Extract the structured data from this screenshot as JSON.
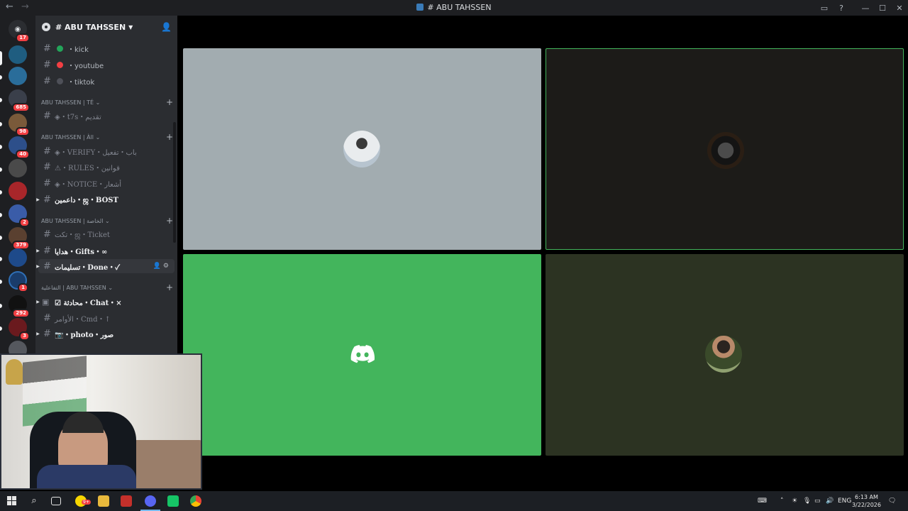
{
  "window": {
    "title": "# ABU TAHSSEN"
  },
  "server_rail": {
    "badges": [
      "17",
      "685",
      "98",
      "40",
      "2",
      "379",
      "1",
      "292",
      "3"
    ]
  },
  "guild": {
    "name": "# ABU TAHSSEN"
  },
  "channels": {
    "top": [
      {
        "label": "・kick",
        "status_color": "#23a55a"
      },
      {
        "label": "・youtube",
        "status_color": "#f23f43"
      },
      {
        "label": "・tiktok",
        "status_color": "#4e5058"
      }
    ],
    "cat1": {
      "label": "ABU TAHSSEN | TÉ"
    },
    "cat1_channels": [
      {
        "label": "◈・t7s・تقديم"
      }
    ],
    "cat2": {
      "label": "ABU TAHSSEN | Àll"
    },
    "cat2_channels": [
      {
        "label": "◈・VERIFY・باب・تفعيل"
      },
      {
        "label": "⚠・RULES・قوانين"
      },
      {
        "label": "◈・NOTICE・أشعار"
      },
      {
        "label": "داعمين・ஜ・BOST"
      }
    ],
    "cat3": {
      "label": "ABU TAHSSEN | الخاصة"
    },
    "cat3_channels": [
      {
        "label": "تكت・ஜ・Ticket"
      },
      {
        "label": "هدايا・Gifts・∞"
      },
      {
        "label": "تسليمات・Done・✓"
      }
    ],
    "cat4": {
      "label": "التفاعلية | ABU TAHSSEN"
    },
    "cat4_channels": [
      {
        "label": "☑ محادثة・Chat・×"
      },
      {
        "label": "الأوامر・Cmd・↑"
      },
      {
        "label": "📷・photo・صور"
      }
    ]
  },
  "taskbar": {
    "language": "ENG",
    "time": "6:13 AM",
    "date": "3/22/2026",
    "snap_badge": "9+"
  },
  "colors": {
    "accent_green": "#43b55c",
    "danger": "#f23f43"
  }
}
